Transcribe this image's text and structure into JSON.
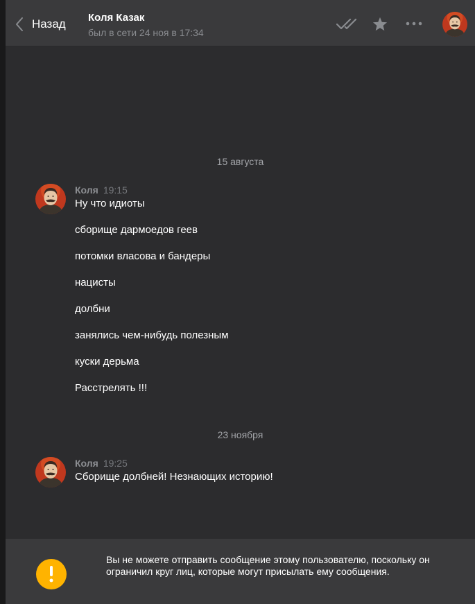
{
  "header": {
    "back_label": "Назад",
    "peer_name": "Коля Казак",
    "peer_status": "был в сети 24 ноя в 17:34",
    "icons": [
      "double-check-icon",
      "star-icon",
      "more-icon",
      "avatar"
    ]
  },
  "chat": {
    "separators": [
      {
        "label": "15 августа"
      },
      {
        "label": "23 ноября"
      }
    ],
    "messages": [
      {
        "author": "Коля",
        "time": "19:15",
        "lines": [
          "Ну что идиоты",
          "сборище дармоедов геев",
          "потомки власова и бандеры",
          "нацисты",
          "долбни",
          "занялись чем-нибудь полезным",
          "куски дерьма",
          "Расстрелять !!!"
        ]
      },
      {
        "author": "Коля",
        "time": "19:25",
        "lines": [
          "Сборище долбней! Незнающих историю!"
        ]
      }
    ]
  },
  "notice": {
    "text": "Вы не можете отправить сообщение этому пользователю, поскольку он ограничил круг лиц, которые могут присылать ему сообщения.",
    "icon": "warning-icon",
    "icon_color": "#ffb300"
  },
  "colors": {
    "background": "#19191a",
    "panel": "#3a3a3c",
    "chat_bg": "#2c2c2e",
    "muted_text": "#8a8c90"
  }
}
